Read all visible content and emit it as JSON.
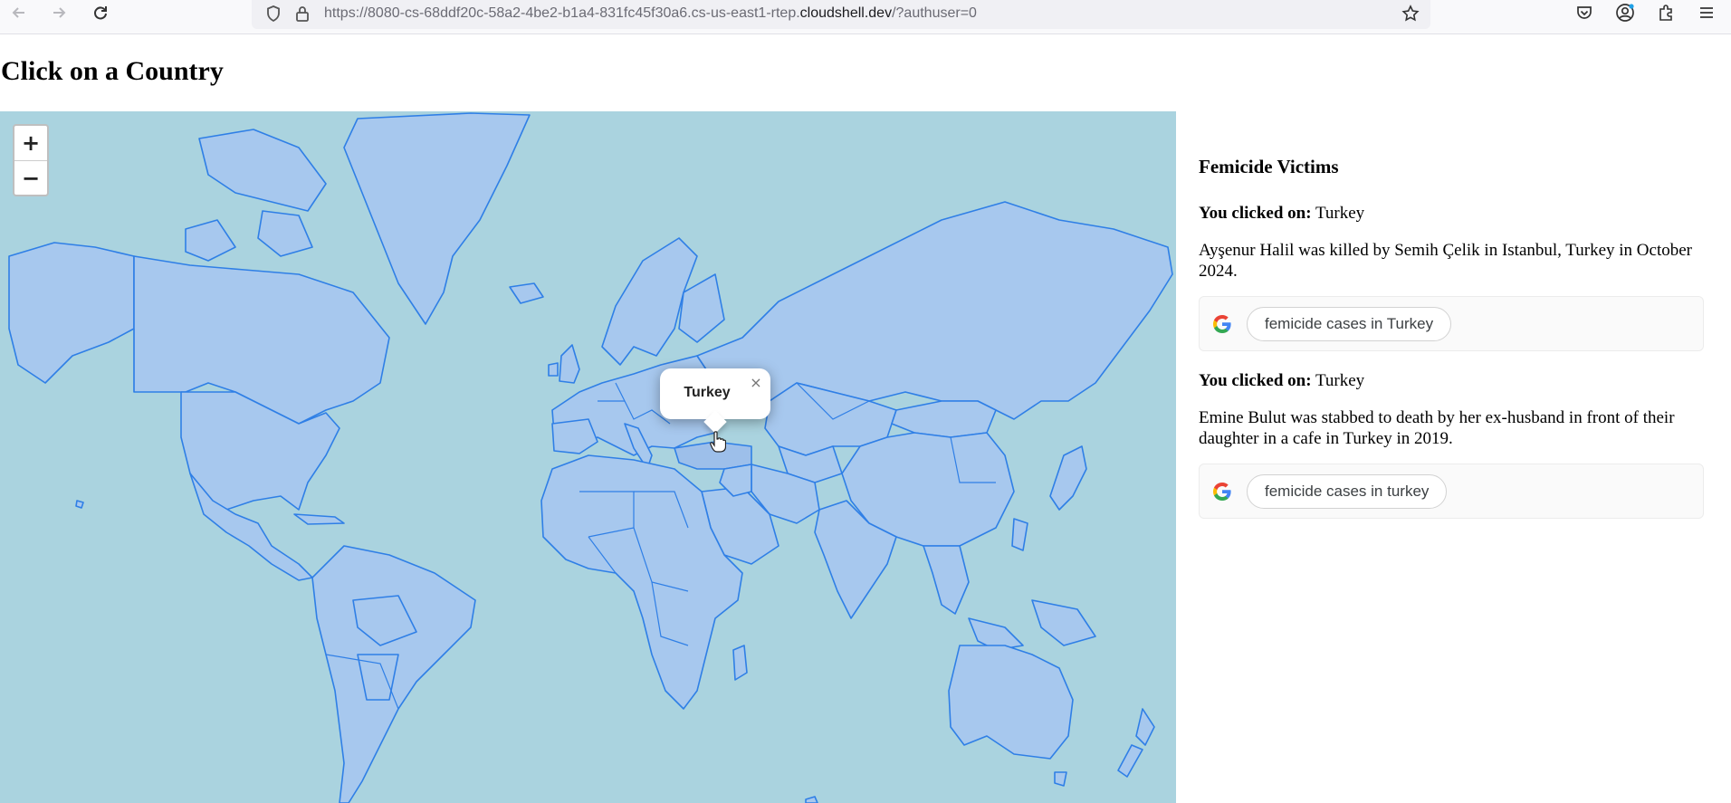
{
  "browser": {
    "url_prefix": "https://8080-cs-68ddf20c-58a2-4be2-b1a4-831fc45f30a6.cs-us-east1-rtep.",
    "url_domain": "cloudshell.dev",
    "url_suffix": "/?authuser=0",
    "icons": [
      "back-arrow-icon",
      "forward-arrow-icon",
      "reload-icon",
      "shield-icon",
      "lock-icon",
      "star-icon",
      "pocket-icon",
      "account-icon",
      "extensions-icon",
      "menu-icon"
    ]
  },
  "page": {
    "title": "Click on a Country"
  },
  "map": {
    "zoom_in": "+",
    "zoom_out": "−",
    "popup_label": "Turkey",
    "popup_close": "×",
    "colors": {
      "ocean": "#aad3df",
      "land": "#a7c8ee",
      "border": "#2f7fe6"
    }
  },
  "panel": {
    "heading": "Femicide Victims",
    "entries": [
      {
        "clicked_label": "You clicked on:",
        "country": " Turkey",
        "story": "Ayşenur Halil was killed by Semih Çelik in Istanbul, Turkey in October 2024.",
        "search_chip": "femicide cases in Turkey"
      },
      {
        "clicked_label": "You clicked on:",
        "country": " Turkey",
        "story": "Emine Bulut was stabbed to death by her ex-husband in front of their daughter in a cafe in Turkey in 2019.",
        "search_chip": "femicide cases in turkey"
      }
    ]
  }
}
